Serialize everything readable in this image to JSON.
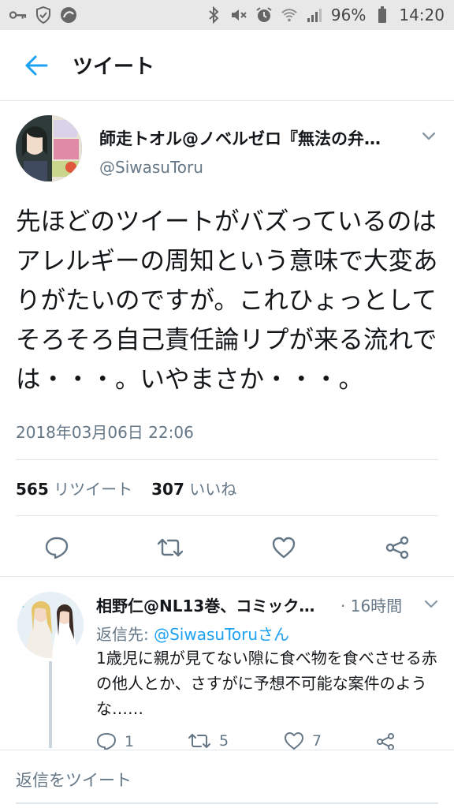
{
  "status_bar": {
    "battery": "96%",
    "time": "14:20",
    "left_icons": [
      "key-icon",
      "shield-icon",
      "data-saver-icon"
    ],
    "right_icons": [
      "bluetooth-icon",
      "mute-icon",
      "alarm-icon",
      "wifi-icon",
      "signal-icon",
      "battery-icon"
    ]
  },
  "appbar": {
    "title": "ツイート",
    "back_icon": "arrow-left-icon"
  },
  "tweet": {
    "author_name": "師走トオル@ノベルゼロ『無法の弁…",
    "handle": "@SiwasuToru",
    "text": "先ほどのツイートがバズっているのはアレルギーの周知という意味で大変ありがたいのですが。これひょっとしてそろそろ自己責任論リプが来る流れでは・・・。いやまさか・・・。",
    "timestamp": "2018年03月06日 22:06",
    "retweets_count": "565",
    "retweets_label": "リツイート",
    "likes_count": "307",
    "likes_label": "いいね"
  },
  "reply": {
    "author_name": "相野仁@NL13巻、コミック…",
    "time": "· 16時間",
    "reply_to_label": "返信先:",
    "reply_to_handle": "@SiwasuToruさん",
    "text": "1歳児に親が見てない隙に食べ物を食べさせる赤の他人とか、さすがに予想不可能な案件のような……",
    "reply_count": "1",
    "retweet_count": "5",
    "like_count": "7"
  },
  "compose": {
    "placeholder": "返信をツイート"
  },
  "colors": {
    "accent": "#1da1f2",
    "secondary_text": "#657786",
    "divider": "#e1e8ed"
  }
}
